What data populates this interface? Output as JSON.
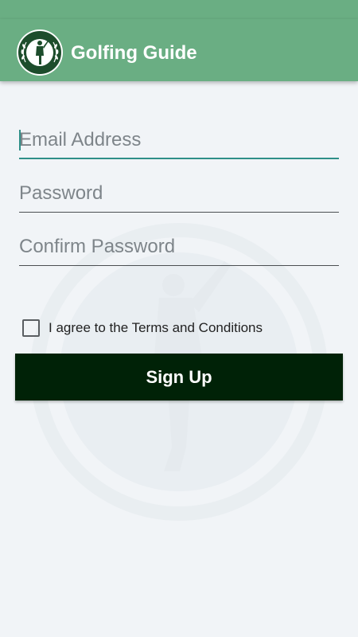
{
  "app_bar": {
    "title": "Golfing Guide",
    "logo_icon": "golfer-laurel-logo-icon",
    "background_color": "#6aae83"
  },
  "form": {
    "email": {
      "placeholder": "Email Address",
      "value": ""
    },
    "password": {
      "placeholder": "Password",
      "value": ""
    },
    "confirm_password": {
      "placeholder": "Confirm Password",
      "value": ""
    },
    "terms": {
      "label": "I agree to the Terms and Conditions",
      "checked": false
    },
    "signup_label": "Sign Up",
    "signup_color": "#002207",
    "focus_color": "#2f8f88"
  }
}
